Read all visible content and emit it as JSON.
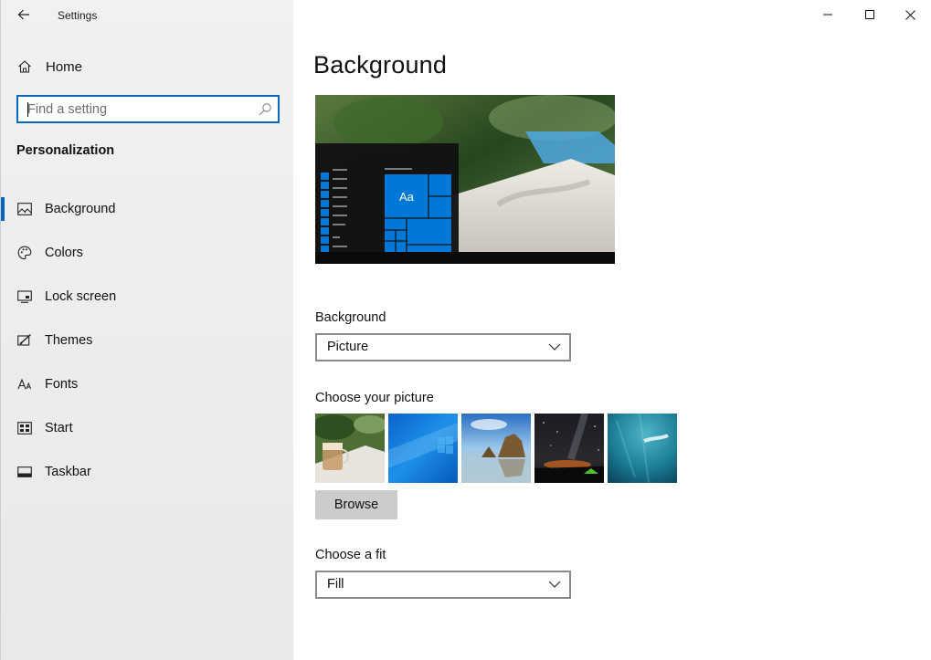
{
  "window": {
    "title": "Settings",
    "controls": {
      "minimize": "minimize-icon",
      "maximize": "maximize-icon",
      "close": "close-icon"
    }
  },
  "sidebar": {
    "home_label": "Home",
    "search": {
      "placeholder": "Find a setting",
      "value": ""
    },
    "section_title": "Personalization",
    "items": [
      {
        "label": "Background",
        "icon": "picture-icon",
        "active": true
      },
      {
        "label": "Colors",
        "icon": "palette-icon",
        "active": false
      },
      {
        "label": "Lock screen",
        "icon": "lock-screen-icon",
        "active": false
      },
      {
        "label": "Themes",
        "icon": "themes-icon",
        "active": false
      },
      {
        "label": "Fonts",
        "icon": "fonts-icon",
        "active": false
      },
      {
        "label": "Start",
        "icon": "start-icon",
        "active": false
      },
      {
        "label": "Taskbar",
        "icon": "taskbar-icon",
        "active": false
      }
    ]
  },
  "main": {
    "page_title": "Background",
    "preview": {
      "tile_text": "Aa"
    },
    "background_label": "Background",
    "background_value": "Picture",
    "choose_picture_label": "Choose your picture",
    "browse_label": "Browse",
    "choose_fit_label": "Choose a fit",
    "fit_value": "Fill"
  },
  "colors": {
    "accent": "#0067c0",
    "tile_blue": "#0078d7"
  }
}
